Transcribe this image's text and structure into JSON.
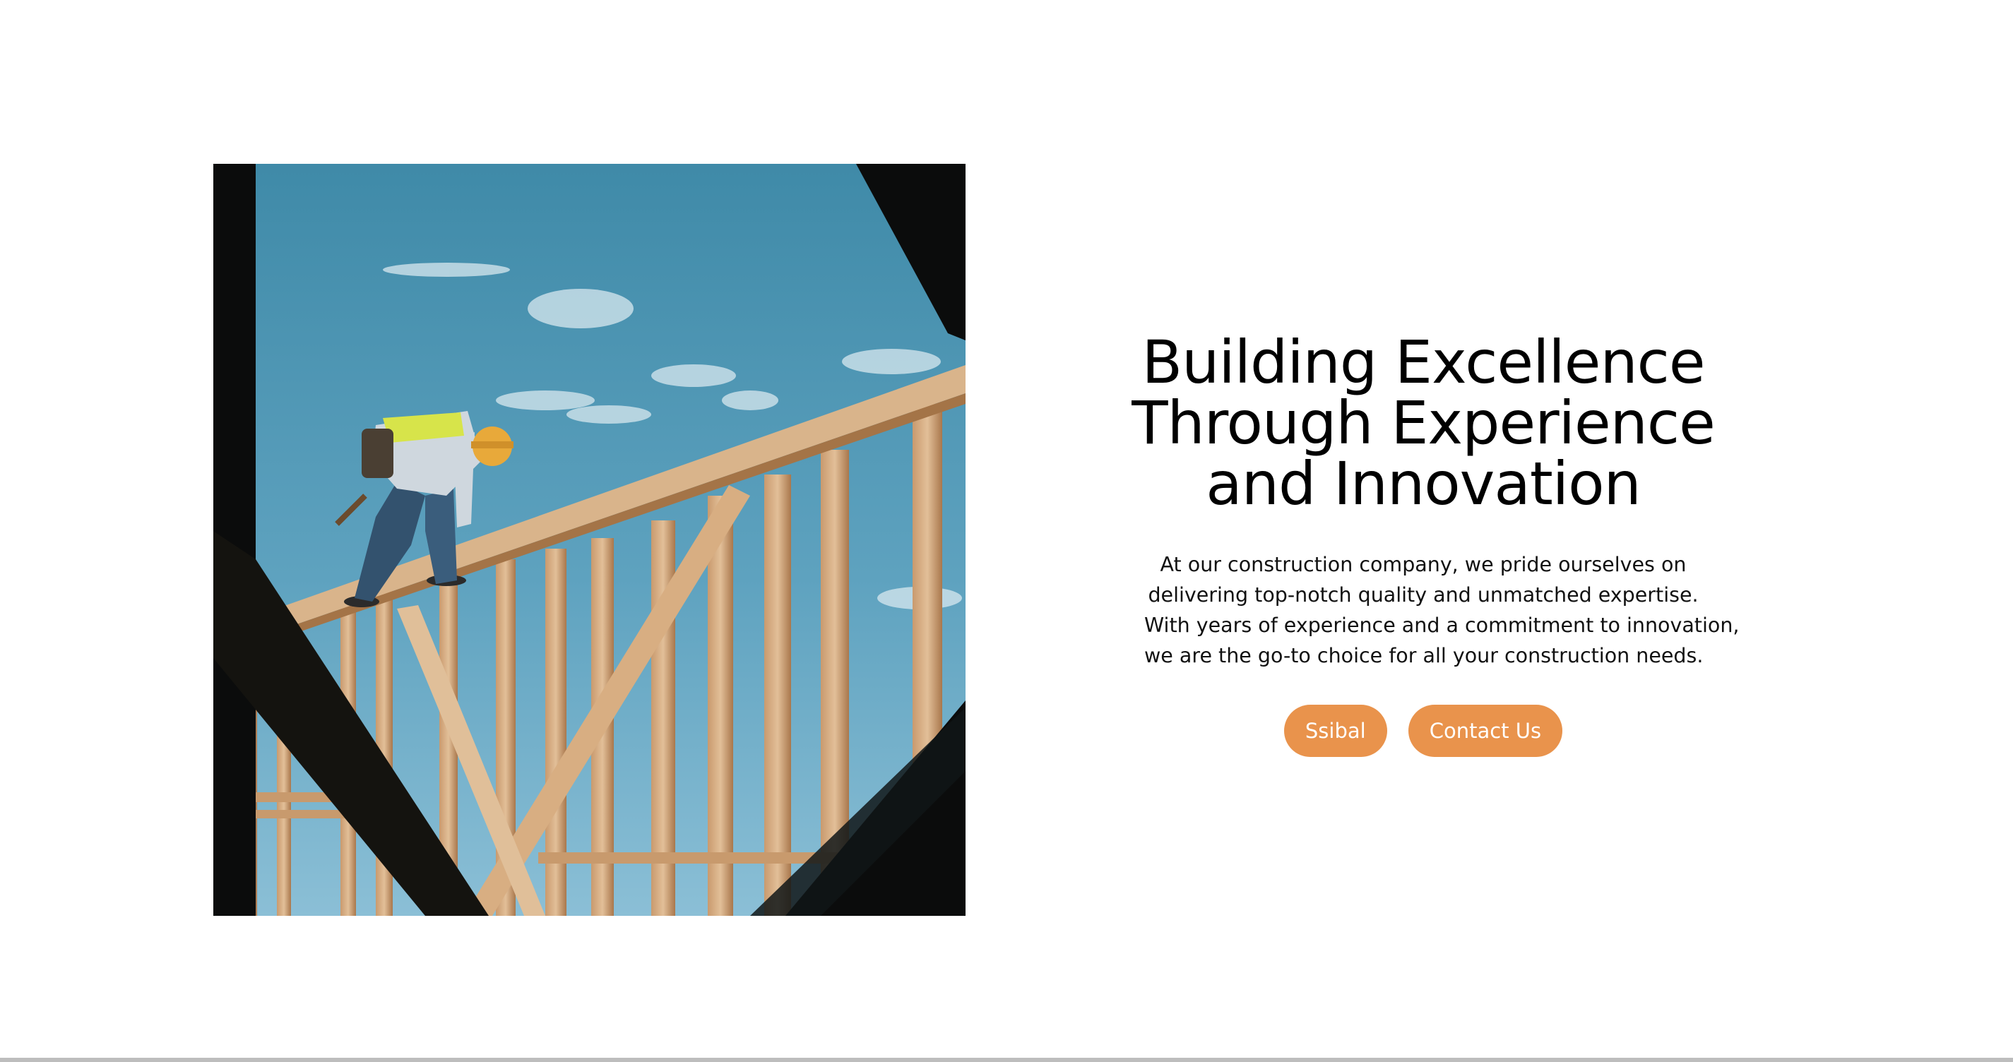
{
  "hero": {
    "headline_lines": [
      "Building Excellence",
      "Through Experience",
      "and Innovation"
    ],
    "body_lines": [
      "At our construction company, we pride ourselves on",
      "delivering top-notch quality and unmatched expertise.",
      "With years of experience and a commitment to innovation,",
      "we are the go-to choice for all your construction needs."
    ],
    "buttons": {
      "primary_label": "Ssibal",
      "secondary_label": "Contact Us"
    }
  },
  "colors": {
    "accent": "#E9934C",
    "text": "#000000",
    "background": "#FFFFFF"
  },
  "image": {
    "subject": "construction worker on wooden roof framing against blue sky"
  }
}
